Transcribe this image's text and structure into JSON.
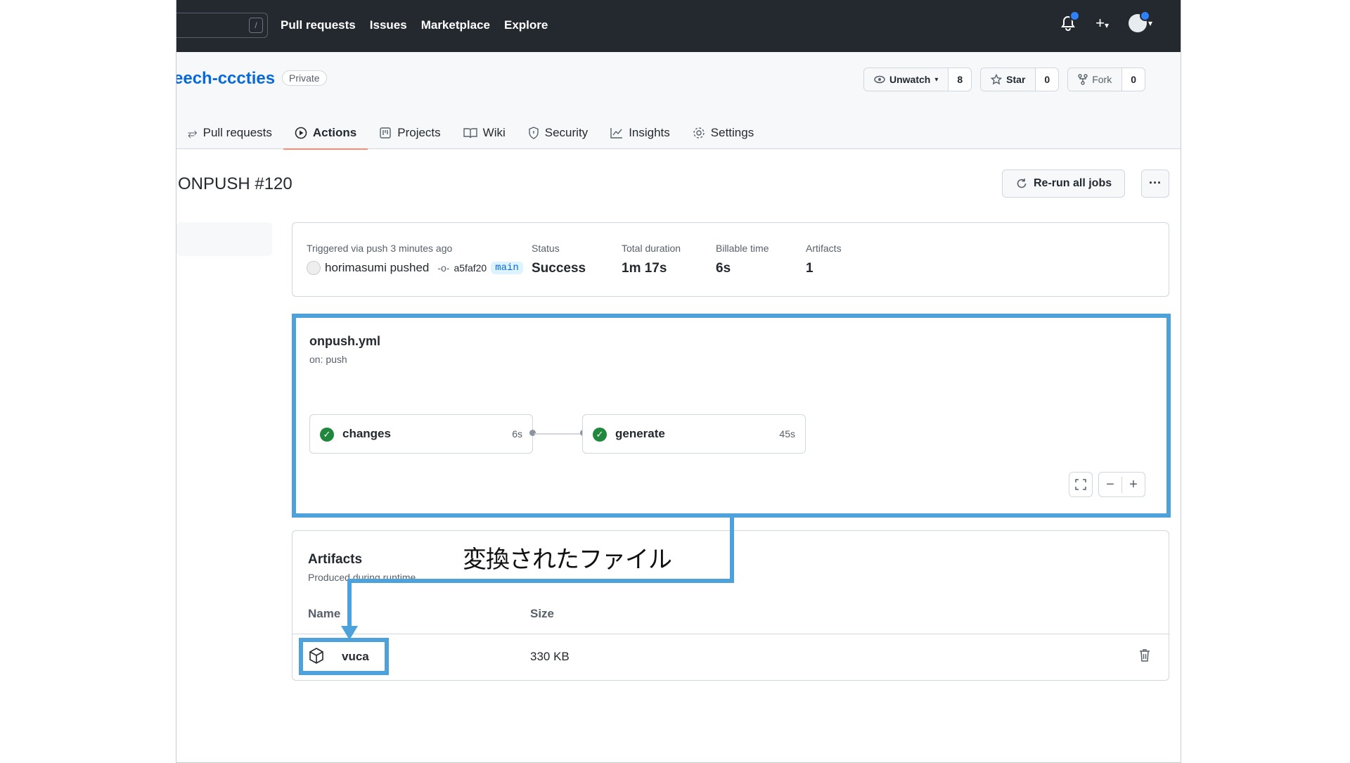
{
  "nav": {
    "search_hint": "/",
    "links": [
      "Pull requests",
      "Issues",
      "Marketplace",
      "Explore"
    ],
    "plus": "+"
  },
  "repo": {
    "name": "eech-cccties",
    "visibility": "Private",
    "watch_label": "Unwatch",
    "watch_count": "8",
    "star_label": "Star",
    "star_count": "0",
    "fork_label": "Fork",
    "fork_count": "0"
  },
  "tabs": [
    {
      "label": "Pull requests",
      "icon": "pull-request-icon"
    },
    {
      "label": "Actions",
      "icon": "play-icon",
      "active": true
    },
    {
      "label": "Projects",
      "icon": "project-icon"
    },
    {
      "label": "Wiki",
      "icon": "book-icon"
    },
    {
      "label": "Security",
      "icon": "shield-icon"
    },
    {
      "label": "Insights",
      "icon": "graph-icon"
    },
    {
      "label": "Settings",
      "icon": "gear-icon"
    }
  ],
  "run": {
    "title": "ONPUSH #120",
    "rerun_label": "Re-run all jobs",
    "more_label": "···"
  },
  "summary": {
    "trigger_label": "Triggered via push 3 minutes ago",
    "actor": "horimasumi pushed",
    "commit": "a5faf20",
    "branch": "main",
    "status_label": "Status",
    "status_value": "Success",
    "duration_label": "Total duration",
    "duration_value": "1m 17s",
    "billable_label": "Billable time",
    "billable_value": "6s",
    "artifacts_label": "Artifacts",
    "artifacts_value": "1"
  },
  "workflow": {
    "file": "onpush.yml",
    "trigger": "on: push",
    "jobs": [
      {
        "name": "changes",
        "time": "6s",
        "status": "success"
      },
      {
        "name": "generate",
        "time": "45s",
        "status": "success"
      }
    ],
    "zoom_out": "−",
    "zoom_in": "+"
  },
  "artifacts": {
    "title": "Artifacts",
    "subtitle": "Produced during runtime",
    "col_name": "Name",
    "col_size": "Size",
    "items": [
      {
        "name": "vuca",
        "size": "330 KB"
      }
    ]
  },
  "annotation": {
    "text": "変換されたファイル",
    "color": "#4ea2dc"
  },
  "colors": {
    "nav_bg": "#24292f",
    "link": "#0969da",
    "success": "#1f883d",
    "active_tab": "#fd8c73"
  }
}
